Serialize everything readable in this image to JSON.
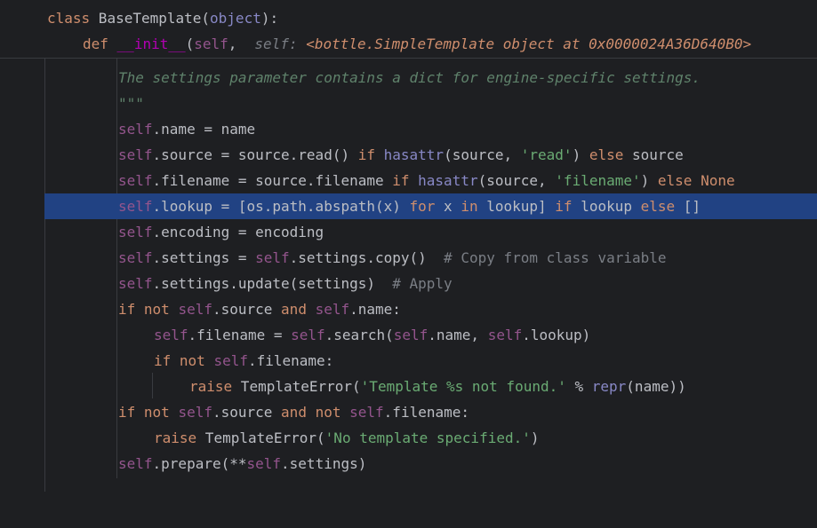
{
  "sticky": {
    "class_line": {
      "kw_class": "class",
      "class_name": " BaseTemplate(",
      "base": "object",
      "close": "):"
    },
    "def_line": {
      "kw_def": "def",
      "sp": " ",
      "method": "__init__",
      "open": "(",
      "self": "self",
      "comma": ",",
      "hint_label": "self:",
      "hint_value": "<bottle.SimpleTemplate object at 0x0000024A36D640B0>"
    }
  },
  "code": {
    "l1": {
      "doc": "The settings parameter contains a dict for engine-specific settings."
    },
    "l2": {
      "doc": "\"\"\""
    },
    "l3": {
      "s": "self",
      "t": ".name = name"
    },
    "l4": {
      "s": "self",
      "t1": ".source = source.read() ",
      "k1": "if",
      "sp": " ",
      "b": "hasattr",
      "t2": "(source, ",
      "str": "'read'",
      "t3": ") ",
      "k2": "else",
      "t4": " source"
    },
    "l5": {
      "s": "self",
      "t1": ".filename = source.filename ",
      "k1": "if",
      "sp": " ",
      "b": "hasattr",
      "t2": "(source, ",
      "str": "'filename'",
      "t3": ") ",
      "k2": "else",
      "sp2": " ",
      "k3": "None"
    },
    "l6": {
      "s": "self",
      "t1": ".lookup = [os.path.abspath(x) ",
      "k1": "for",
      "t2": " x ",
      "k2": "in",
      "t3": " lookup] ",
      "k3": "if",
      "t4": " lookup ",
      "k4": "else",
      "t5": " []"
    },
    "l7": {
      "s": "self",
      "t": ".encoding = encoding"
    },
    "l8": {
      "s": "self",
      "t1": ".settings = ",
      "s2": "self",
      "t2": ".settings.copy()  ",
      "cm": "# Copy from class variable"
    },
    "l9": {
      "s": "self",
      "t1": ".settings.update(settings)  ",
      "cm": "# Apply"
    },
    "l10": {
      "k1": "if",
      "sp": " ",
      "k2": "not",
      "sp2": " ",
      "s": "self",
      "t1": ".source ",
      "k3": "and",
      "sp3": " ",
      "s2": "self",
      "t2": ".name:"
    },
    "l11": {
      "s": "self",
      "t1": ".filename = ",
      "s2": "self",
      "t2": ".search(",
      "s3": "self",
      "t3": ".name, ",
      "s4": "self",
      "t4": ".lookup)"
    },
    "l12": {
      "k1": "if",
      "sp": " ",
      "k2": "not",
      "sp2": " ",
      "s": "self",
      "t": ".filename:"
    },
    "l13": {
      "k": "raise",
      "t1": " TemplateError(",
      "str": "'Template %s not found.'",
      "t2": " % ",
      "b": "repr",
      "t3": "(name))"
    },
    "l14": {
      "k1": "if",
      "sp": " ",
      "k2": "not",
      "sp2": " ",
      "s": "self",
      "t1": ".source ",
      "k3": "and",
      "sp3": " ",
      "k4": "not",
      "sp4": " ",
      "s2": "self",
      "t2": ".filename:"
    },
    "l15": {
      "k": "raise",
      "t1": " TemplateError(",
      "str": "'No template specified.'",
      "t2": ")"
    },
    "l16": {
      "s": "self",
      "t1": ".prepare(**",
      "s2": "self",
      "t2": ".settings)"
    }
  },
  "colors": {
    "background": "#1e1f22",
    "selection": "#214283",
    "keyword": "#cf8e6d",
    "self": "#94558d",
    "string": "#6aab73",
    "comment": "#7a7e85",
    "docstring": "#5f826b"
  }
}
